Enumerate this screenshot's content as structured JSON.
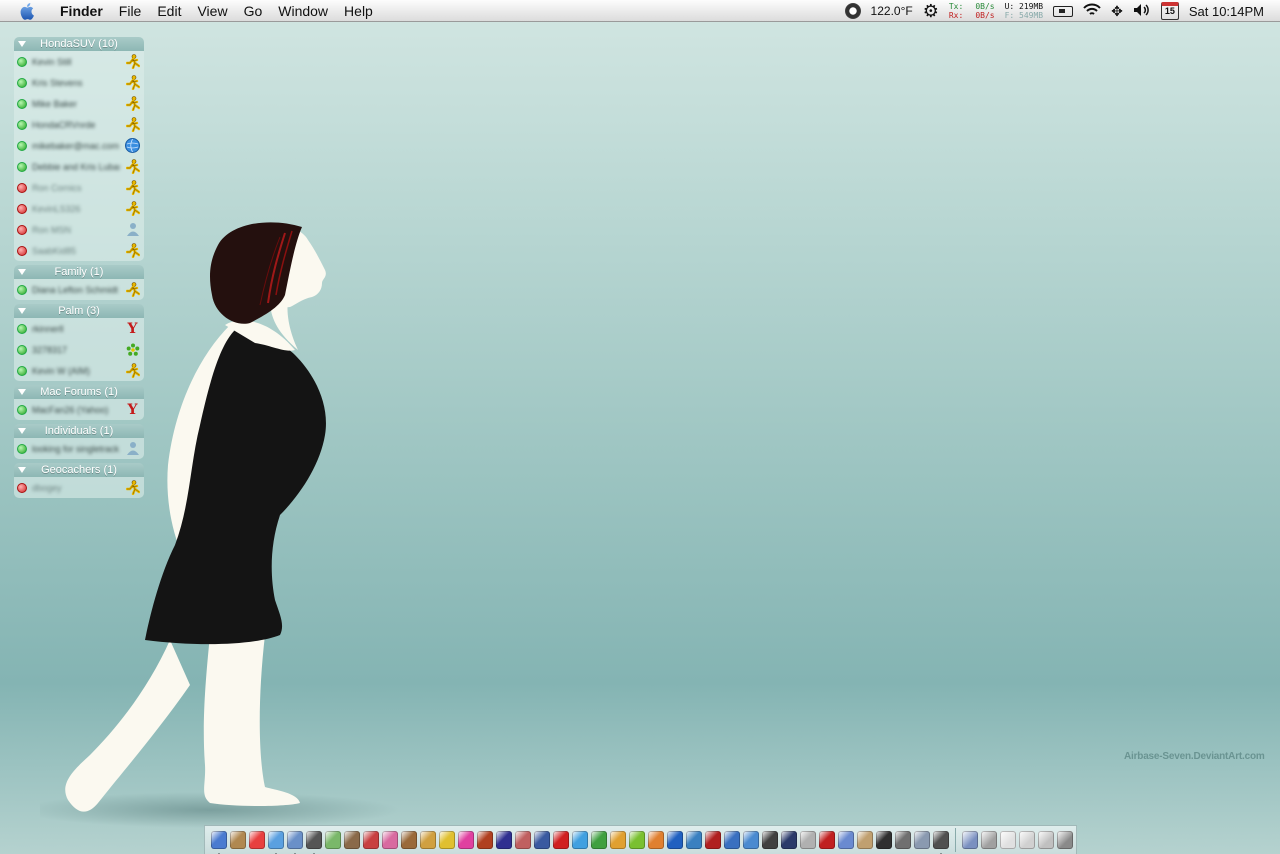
{
  "menubar": {
    "app": "Finder",
    "menus": [
      "File",
      "Edit",
      "View",
      "Go",
      "Window",
      "Help"
    ],
    "temperature": "122.0°F",
    "net_tx_label": "Tx:",
    "net_rx_label": "Rx:",
    "net_tx": "0B/s",
    "net_rx": "0B/s",
    "mem_used": "U: 219MB",
    "mem_free": "F: 549MB",
    "calendar_day": "15",
    "clock": "Sat 10:14PM"
  },
  "buddy_list": {
    "groups": [
      {
        "title": "HondaSUV (10)",
        "buddies": [
          {
            "name": "Kevin Still",
            "status": "online",
            "service": "aim-icon"
          },
          {
            "name": "Kris Stevens",
            "status": "online",
            "service": "aim-icon"
          },
          {
            "name": "Mike Baker",
            "status": "online",
            "service": "aim-icon"
          },
          {
            "name": "HondaCRVnrde",
            "status": "online",
            "service": "aim-icon"
          },
          {
            "name": "mikebaker@mac.com",
            "status": "online",
            "service": "mac-globe-icon"
          },
          {
            "name": "Debbie and Kris Lubas",
            "status": "online",
            "service": "aim-icon"
          },
          {
            "name": "Ron Cornics",
            "status": "offline",
            "service": "aim-icon"
          },
          {
            "name": "KevinLS326",
            "status": "offline",
            "service": "aim-icon"
          },
          {
            "name": "Ron MSN",
            "status": "offline",
            "service": "msn-icon"
          },
          {
            "name": "SaabKid85",
            "status": "offline",
            "service": "aim-icon"
          }
        ]
      },
      {
        "title": "Family (1)",
        "buddies": [
          {
            "name": "Diana Lefton Schmidt",
            "status": "online",
            "service": "aim-icon"
          }
        ]
      },
      {
        "title": "Palm (3)",
        "buddies": [
          {
            "name": "rkinnerll",
            "status": "online",
            "service": "yahoo-icon"
          },
          {
            "name": "3278317",
            "status": "online",
            "service": "icq-icon"
          },
          {
            "name": "Kevin W (AIM)",
            "status": "online",
            "service": "aim-icon"
          }
        ]
      },
      {
        "title": "Mac Forums (1)",
        "buddies": [
          {
            "name": "MacFan26 (Yahoo)",
            "status": "online",
            "service": "yahoo-icon"
          }
        ]
      },
      {
        "title": "Individuals (1)",
        "buddies": [
          {
            "name": "looking for singletrack",
            "status": "online",
            "service": "msn-icon"
          }
        ]
      },
      {
        "title": "Geocachers (1)",
        "buddies": [
          {
            "name": "dbogey",
            "status": "offline",
            "service": "aim-icon"
          }
        ]
      }
    ]
  },
  "wallpaper": {
    "watermark": "Airbase-Seven.DeviantArt.com"
  },
  "dock": {
    "apps": [
      {
        "name": "finder-icon",
        "color": "#4a7bd0",
        "running": true
      },
      {
        "name": "address-book-icon",
        "color": "#b08850",
        "running": false
      },
      {
        "name": "ical-icon",
        "color": "#e84040",
        "running": false
      },
      {
        "name": "safari-icon",
        "color": "#5aa0e0",
        "running": true
      },
      {
        "name": "mail-icon",
        "color": "#6a90c8",
        "running": true
      },
      {
        "name": "terminal-icon",
        "color": "#555555",
        "running": true
      },
      {
        "name": "itunes-icon",
        "color": "#7ab86a",
        "running": false
      },
      {
        "name": "iphoto-icon",
        "color": "#8a6a4a",
        "running": false
      },
      {
        "name": "photo-booth-icon",
        "color": "#c84040",
        "running": false
      },
      {
        "name": "preview-icon",
        "color": "#d86aa0",
        "running": false
      },
      {
        "name": "garage-band-icon",
        "color": "#9a6a3a",
        "running": false
      },
      {
        "name": "text-edit-icon",
        "color": "#d0a040",
        "running": false
      },
      {
        "name": "pencil-icon",
        "color": "#e0c030",
        "running": false
      },
      {
        "name": "flower-icon",
        "color": "#e040a0",
        "running": false
      },
      {
        "name": "script-editor-icon",
        "color": "#b04020",
        "running": false
      },
      {
        "name": "star-icon",
        "color": "#303090",
        "running": false
      },
      {
        "name": "utility-icon",
        "color": "#c06060",
        "running": false
      },
      {
        "name": "network-icon",
        "color": "#3a5aa0",
        "running": false
      },
      {
        "name": "opera-icon",
        "color": "#d02020",
        "running": false
      },
      {
        "name": "word-icon",
        "color": "#40a0e0",
        "running": false
      },
      {
        "name": "excel-icon",
        "color": "#40a040",
        "running": false
      },
      {
        "name": "powerpoint-icon",
        "color": "#e0a030",
        "running": false
      },
      {
        "name": "green-app-icon",
        "color": "#7ac030",
        "running": false
      },
      {
        "name": "firefox-icon",
        "color": "#e08030",
        "running": false
      },
      {
        "name": "vlc-icon",
        "color": "#2060c0",
        "running": false
      },
      {
        "name": "globe-icon",
        "color": "#3a80c0",
        "running": false
      },
      {
        "name": "record-icon",
        "color": "#b02020",
        "running": false
      },
      {
        "name": "quicktime-icon",
        "color": "#3a70c0",
        "running": false
      },
      {
        "name": "search-icon",
        "color": "#4a8ad0",
        "running": false
      },
      {
        "name": "gear-icon",
        "color": "#404040",
        "running": false
      },
      {
        "name": "disk-icon",
        "color": "#2a3a6a",
        "running": false
      },
      {
        "name": "camera-icon",
        "color": "#b0b0b0",
        "running": false
      },
      {
        "name": "stop-icon",
        "color": "#c02020",
        "running": false
      },
      {
        "name": "font-icon",
        "color": "#6a8ad0",
        "running": false
      },
      {
        "name": "lock-icon",
        "color": "#c0a070",
        "running": false
      },
      {
        "name": "gear2-icon",
        "color": "#303030",
        "running": false
      },
      {
        "name": "network-utility-icon",
        "color": "#707070",
        "running": false
      },
      {
        "name": "scanner-icon",
        "color": "#8a9ab0",
        "running": false
      },
      {
        "name": "activity-monitor-icon",
        "color": "#505050",
        "running": true
      }
    ],
    "docked": [
      {
        "name": "document-icon",
        "color": "#7a90c0"
      },
      {
        "name": "magnifier-icon",
        "color": "#a0a0a0"
      },
      {
        "name": "window-icon",
        "color": "#e0e0e0"
      },
      {
        "name": "stack-icon",
        "color": "#d0d0d0"
      },
      {
        "name": "printer-icon",
        "color": "#c0c0c0"
      },
      {
        "name": "trash-icon",
        "color": "#8a8a8a"
      }
    ]
  }
}
